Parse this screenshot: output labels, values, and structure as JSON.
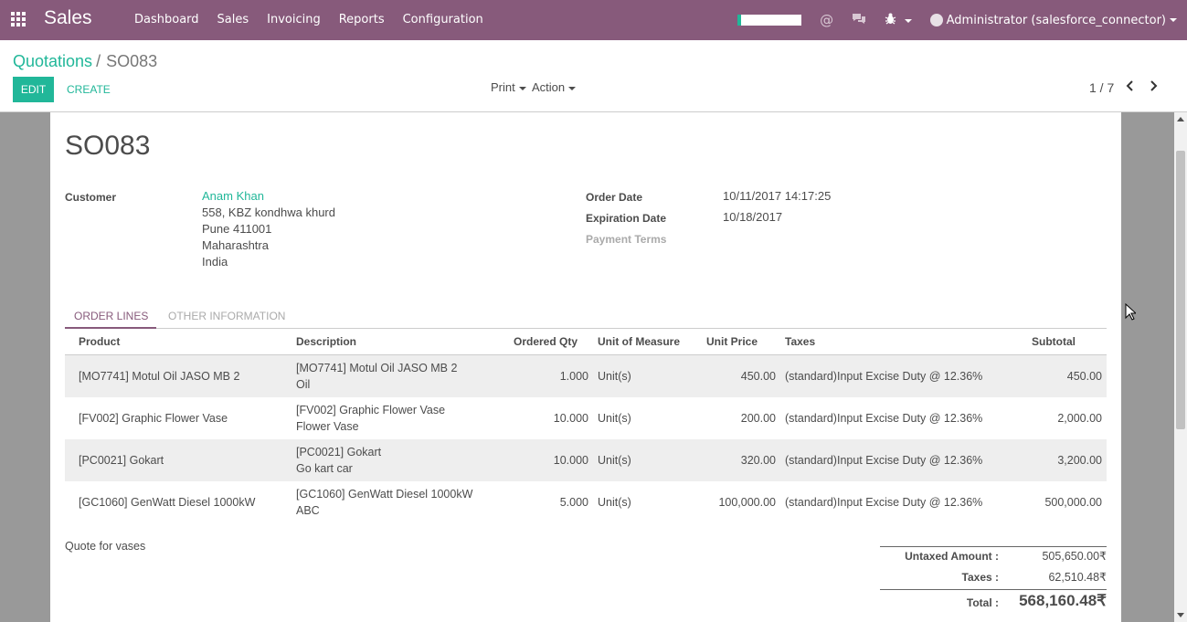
{
  "navbar": {
    "brand": "Sales",
    "menu": [
      "Dashboard",
      "Sales",
      "Invoicing",
      "Reports",
      "Configuration"
    ],
    "user": "Administrator (salesforce_connector)"
  },
  "breadcrumb": {
    "parent": "Quotations",
    "separator": "/",
    "current": "SO083"
  },
  "toolbar": {
    "edit_label": "EDIT",
    "create_label": "CREATE",
    "print_label": "Print",
    "action_label": "Action",
    "pager": "1 / 7"
  },
  "record": {
    "title": "SO083",
    "customer_label": "Customer",
    "customer_name": "Anam Khan",
    "address": [
      "558, KBZ kondhwa khurd",
      "Pune 411001",
      "Maharashtra",
      "India"
    ],
    "order_date_label": "Order Date",
    "order_date": "10/11/2017 14:17:25",
    "expiration_label": "Expiration Date",
    "expiration_date": "10/18/2017",
    "payment_terms_label": "Payment Terms"
  },
  "tabs": [
    "ORDER LINES",
    "OTHER INFORMATION"
  ],
  "table": {
    "headers": [
      "Product",
      "Description",
      "Ordered Qty",
      "Unit of Measure",
      "Unit Price",
      "Taxes",
      "Subtotal"
    ],
    "rows": [
      {
        "product": "[MO7741] Motul Oil JASO MB 2",
        "desc1": "[MO7741] Motul Oil JASO MB 2",
        "desc2": "Oil",
        "qty": "1.000",
        "uom": "Unit(s)",
        "price": "450.00",
        "taxes": "(standard)Input Excise Duty @ 12.36%",
        "subtotal": "450.00"
      },
      {
        "product": "[FV002] Graphic Flower Vase",
        "desc1": "[FV002] Graphic Flower Vase",
        "desc2": "Flower Vase",
        "qty": "10.000",
        "uom": "Unit(s)",
        "price": "200.00",
        "taxes": "(standard)Input Excise Duty @ 12.36%",
        "subtotal": "2,000.00"
      },
      {
        "product": "[PC0021] Gokart",
        "desc1": "[PC0021] Gokart",
        "desc2": "Go kart car",
        "qty": "10.000",
        "uom": "Unit(s)",
        "price": "320.00",
        "taxes": "(standard)Input Excise Duty @ 12.36%",
        "subtotal": "3,200.00"
      },
      {
        "product": "[GC1060] GenWatt Diesel 1000kW",
        "desc1": "[GC1060] GenWatt Diesel 1000kW",
        "desc2": "ABC",
        "qty": "5.000",
        "uom": "Unit(s)",
        "price": "100,000.00",
        "taxes": "(standard)Input Excise Duty @ 12.36%",
        "subtotal": "500,000.00"
      }
    ]
  },
  "note": "Quote for vases",
  "totals": {
    "untaxed_label": "Untaxed Amount :",
    "untaxed_value": "505,650.00₹",
    "taxes_label": "Taxes :",
    "taxes_value": "62,510.48₹",
    "total_label": "Total :",
    "total_value": "568,160.48₹"
  },
  "colors": {
    "navbar": "#875a7b",
    "accent": "#21b799"
  },
  "icons": {
    "apps": "apps-grid-icon",
    "mention": "at-icon",
    "chat": "chat-bubbles-icon",
    "debug": "bug-icon",
    "prev": "chevron-left-icon",
    "next": "chevron-right-icon"
  }
}
